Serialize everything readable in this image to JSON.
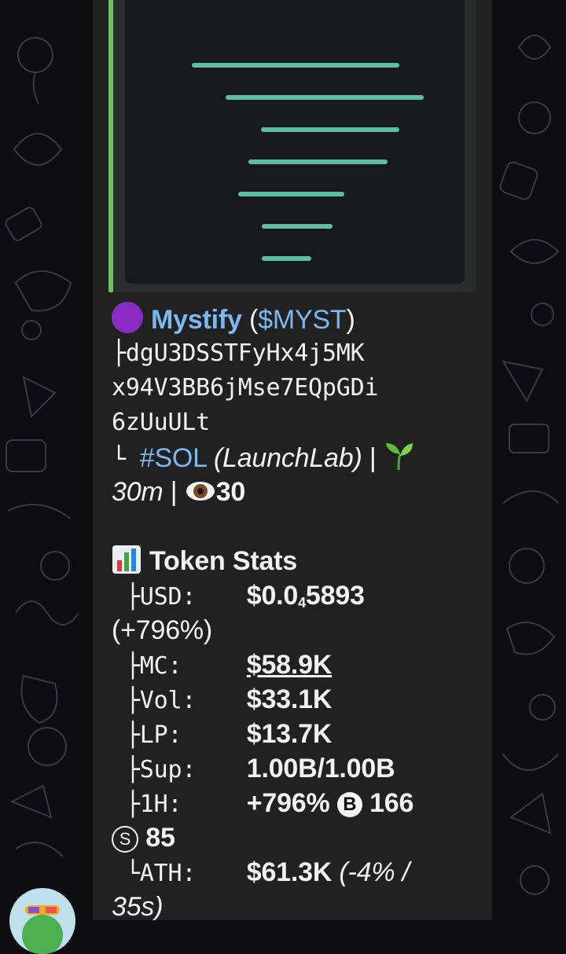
{
  "token": {
    "emoji_icon": "purple-circle-icon",
    "name": "Mystify",
    "ticker_open": "(",
    "ticker": "$MYST",
    "ticker_close": ")",
    "address_line1": "dgU3DSSTFyHx4j5MK",
    "address_line2": "x94V3BB6jMse7EQpGDi",
    "address_line3": "6zUuULt",
    "chain_tag": "#SOL",
    "platform": "(LaunchLab)",
    "sep1": "|",
    "age": "30m",
    "sep2": "|",
    "views": "30"
  },
  "stats": {
    "header_icon": "bar-chart-icon",
    "header": "Token Stats",
    "usd_label": "USD:",
    "usd_prefix": "$0.0",
    "usd_sub": "4",
    "usd_digits": "5893",
    "usd_change": "(+796%)",
    "mc_label": "MC:",
    "mc_value": "$58.9K",
    "vol_label": "Vol:",
    "vol_value": "$33.1K",
    "lp_label": "LP:",
    "lp_value": "$13.7K",
    "sup_label": "Sup:",
    "sup_value": "1.00B/1.00B",
    "h1_label": "1H:",
    "h1_change": "+796%",
    "buys_badge": "B",
    "buys": "166",
    "sells_badge": "S",
    "sells": "85",
    "ath_label": "ATH:",
    "ath_value": "$61.3K",
    "ath_note_a": "(-4% /",
    "ath_note_b": "35s)"
  },
  "colors": {
    "link": "#7bb8f0",
    "accent_bar": "#6cc655",
    "preview_lines": "#5dbf9d",
    "bubble": "#212121"
  }
}
